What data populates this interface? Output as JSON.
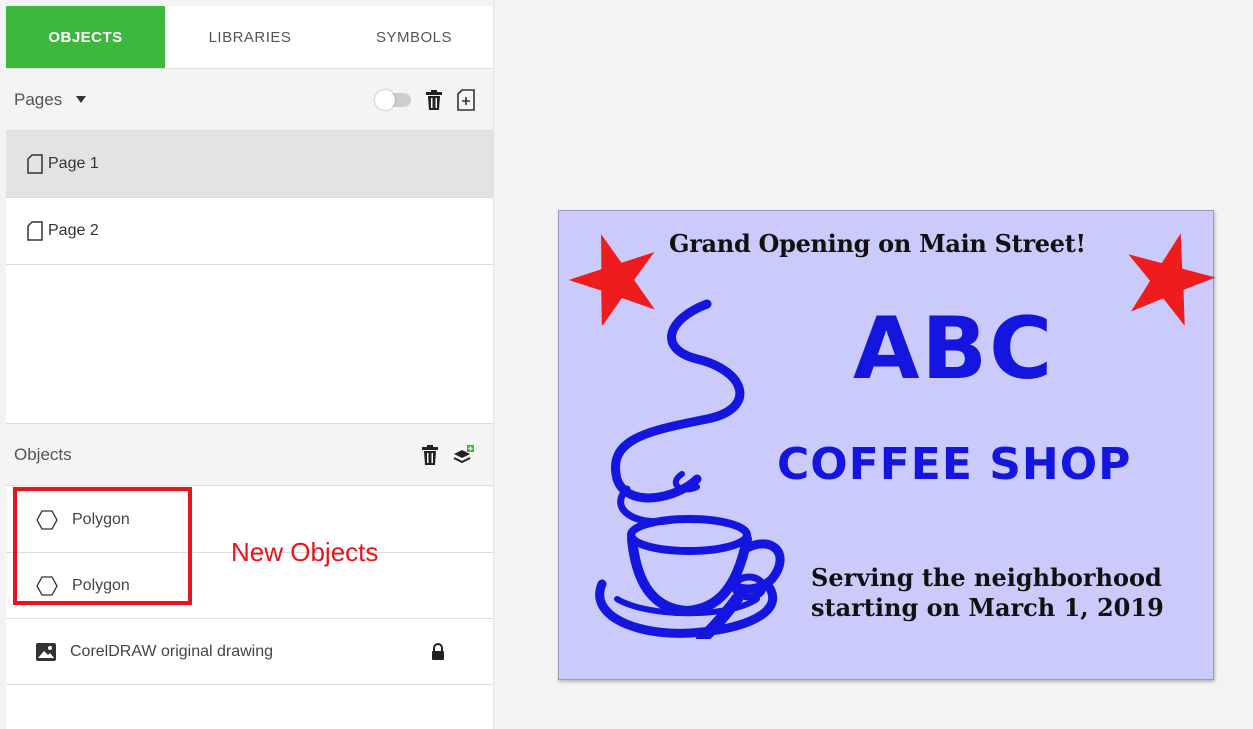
{
  "tabs": [
    {
      "label": "OBJECTS"
    },
    {
      "label": "LIBRARIES"
    },
    {
      "label": "SYMBOLS"
    }
  ],
  "pages_panel": {
    "title": "Pages",
    "items": [
      {
        "label": "Page 1",
        "selected": true
      },
      {
        "label": "Page 2",
        "selected": false
      }
    ]
  },
  "objects_panel": {
    "title": "Objects",
    "items": [
      {
        "label": "Polygon",
        "icon": "hexagon-icon"
      },
      {
        "label": "Polygon",
        "icon": "hexagon-icon"
      },
      {
        "label": "CorelDRAW original drawing",
        "icon": "image-icon",
        "locked": true
      }
    ]
  },
  "annotation": {
    "label": "New Objects",
    "color": "#e8131b"
  },
  "poster": {
    "headline": "Grand Opening on Main Street!",
    "brand": "ABC",
    "subtitle": "COFFEE SHOP",
    "line1": "Serving the neighborhood",
    "line2": "starting on March 1, 2019",
    "background": "#cacbfa",
    "accent": "#1515e0",
    "star_color": "#ee1c1c"
  },
  "colors": {
    "active_tab": "#3cb93c"
  }
}
